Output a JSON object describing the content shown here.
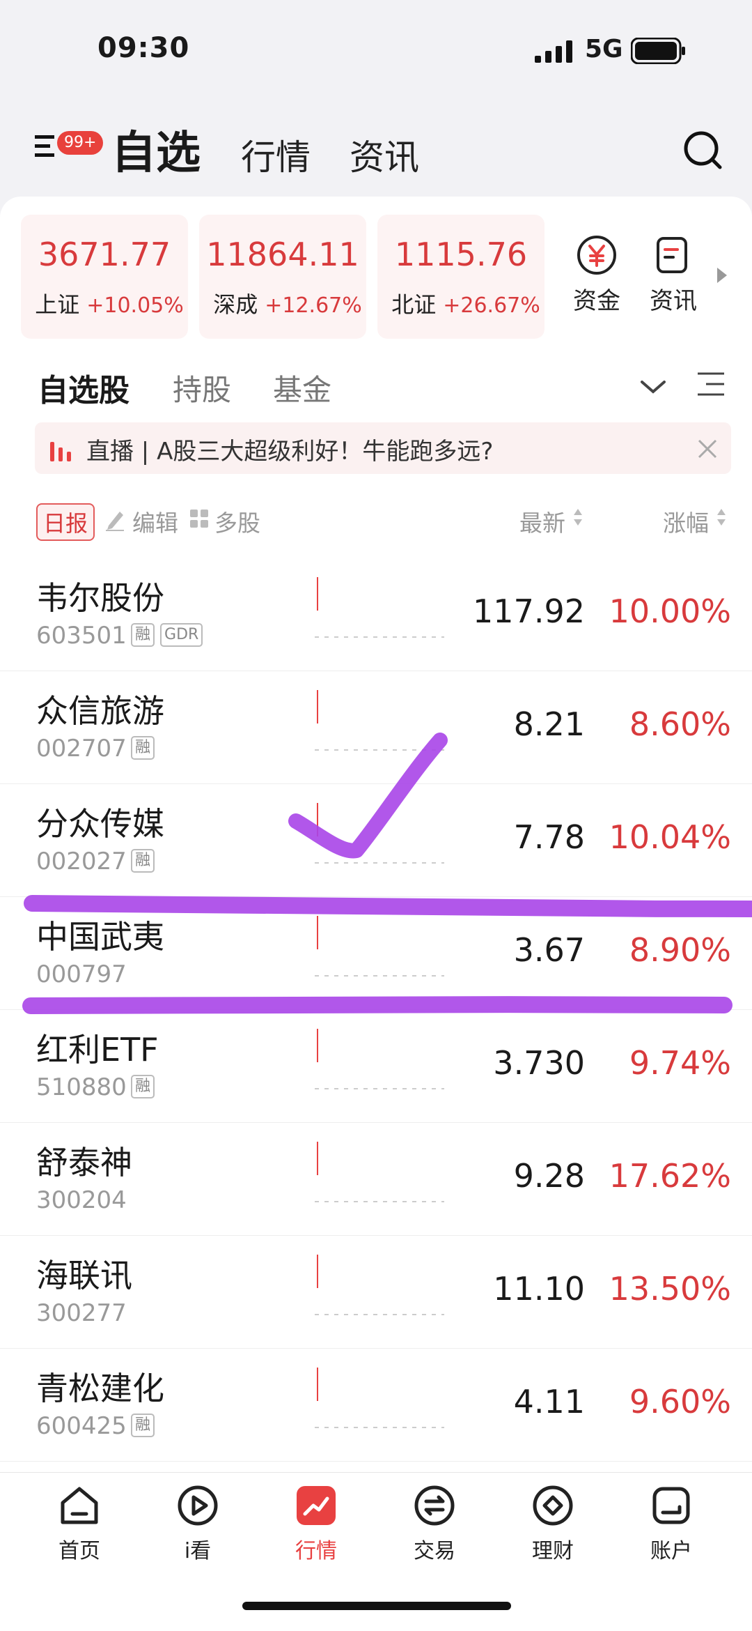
{
  "status_bar": {
    "time": "09:30",
    "network": "5G"
  },
  "header": {
    "badge": "99+",
    "tabs": [
      "自选",
      "行情",
      "资讯"
    ]
  },
  "indices": [
    {
      "value": "3671.77",
      "name": "上证",
      "change": "+10.05%"
    },
    {
      "value": "11864.11",
      "name": "深成",
      "change": "+12.67%"
    },
    {
      "value": "1115.76",
      "name": "北证",
      "change": "+26.67%"
    }
  ],
  "quick_links": [
    {
      "label": "资金",
      "icon": "yuan-circle-icon"
    },
    {
      "label": "资讯",
      "icon": "news-icon"
    }
  ],
  "sub_tabs": [
    "自选股",
    "持股",
    "基金"
  ],
  "banner": {
    "text": "直播 | A股三大超级利好！牛能跑多远?"
  },
  "list_header": {
    "daily": "日报",
    "edit": "编辑",
    "multi": "多股",
    "latest": "最新",
    "change": "涨幅"
  },
  "stocks": [
    {
      "name": "韦尔股份",
      "code": "603501",
      "tags": [
        "融",
        "GDR"
      ],
      "price": "117.92",
      "change": "10.00%"
    },
    {
      "name": "众信旅游",
      "code": "002707",
      "tags": [
        "融"
      ],
      "price": "8.21",
      "change": "8.60%"
    },
    {
      "name": "分众传媒",
      "code": "002027",
      "tags": [
        "融"
      ],
      "price": "7.78",
      "change": "10.04%"
    },
    {
      "name": "中国武夷",
      "code": "000797",
      "tags": [],
      "price": "3.67",
      "change": "8.90%"
    },
    {
      "name": "红利ETF",
      "code": "510880",
      "tags": [
        "融"
      ],
      "price": "3.730",
      "change": "9.74%"
    },
    {
      "name": "舒泰神",
      "code": "300204",
      "tags": [],
      "price": "9.28",
      "change": "17.62%"
    },
    {
      "name": "海联讯",
      "code": "300277",
      "tags": [],
      "price": "11.10",
      "change": "13.50%"
    },
    {
      "name": "青松建化",
      "code": "600425",
      "tags": [
        "融"
      ],
      "price": "4.11",
      "change": "9.60%"
    }
  ],
  "bottom_nav": [
    {
      "label": "首页",
      "icon": "home-icon"
    },
    {
      "label": "i看",
      "icon": "play-icon"
    },
    {
      "label": "行情",
      "icon": "trend-icon",
      "active": true
    },
    {
      "label": "交易",
      "icon": "exchange-icon"
    },
    {
      "label": "理财",
      "icon": "finance-icon"
    },
    {
      "label": "账户",
      "icon": "account-icon"
    }
  ],
  "colors": {
    "up": "#d83a3c",
    "accent": "#e84141",
    "marker": "#a945e8"
  }
}
